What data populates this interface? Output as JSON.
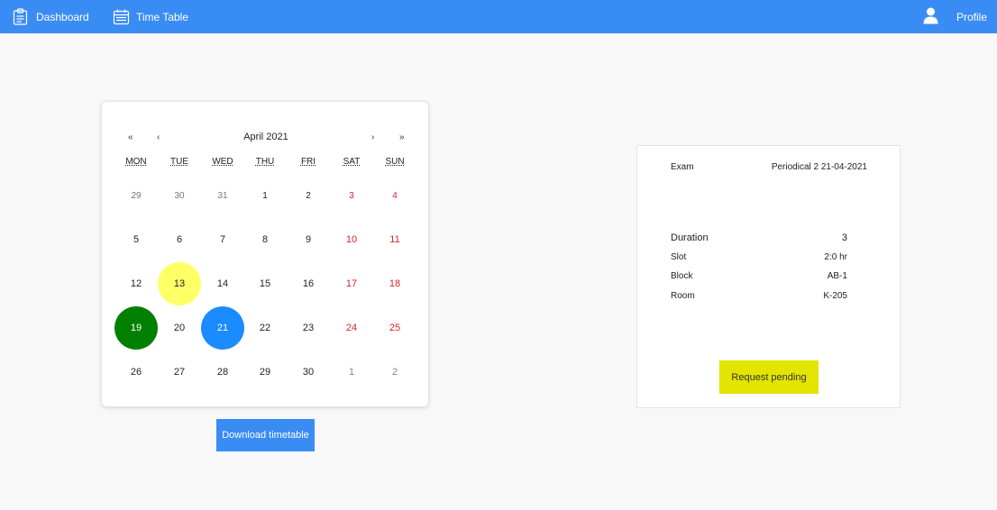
{
  "nav": {
    "dashboard_label": "Dashboard",
    "timetable_label": "Time Table",
    "profile_label": "Profile",
    "bar_color": "#3a8cf5"
  },
  "calendar": {
    "month_label": "April 2021",
    "prev_year": "«",
    "prev_month": "‹",
    "next_month": "›",
    "next_year": "»",
    "weekdays": [
      "MON",
      "TUE",
      "WED",
      "THU",
      "FRI",
      "SAT",
      "SUN"
    ],
    "weeks": [
      [
        {
          "label": "29",
          "other": true
        },
        {
          "label": "30",
          "other": true
        },
        {
          "label": "31",
          "other": true
        },
        {
          "label": "1"
        },
        {
          "label": "2"
        },
        {
          "label": "3",
          "weekend": true
        },
        {
          "label": "4",
          "weekend": true
        }
      ],
      [
        {
          "label": "5"
        },
        {
          "label": "6"
        },
        {
          "label": "7"
        },
        {
          "label": "8"
        },
        {
          "label": "9"
        },
        {
          "label": "10",
          "weekend": true
        },
        {
          "label": "11",
          "weekend": true
        }
      ],
      [
        {
          "label": "12"
        },
        {
          "label": "13",
          "highlight": "#ffff66"
        },
        {
          "label": "14"
        },
        {
          "label": "15"
        },
        {
          "label": "16"
        },
        {
          "label": "17",
          "weekend": true
        },
        {
          "label": "18",
          "weekend": true
        }
      ],
      [
        {
          "label": "19",
          "highlight": "#008000",
          "light": true
        },
        {
          "label": "20"
        },
        {
          "label": "21",
          "highlight": "#1a8cff",
          "light": true
        },
        {
          "label": "22"
        },
        {
          "label": "23"
        },
        {
          "label": "24",
          "weekend": true
        },
        {
          "label": "25",
          "weekend": true
        }
      ],
      [
        {
          "label": "26"
        },
        {
          "label": "27"
        },
        {
          "label": "28"
        },
        {
          "label": "29"
        },
        {
          "label": "30"
        },
        {
          "label": "1",
          "other": true
        },
        {
          "label": "2",
          "other": true
        }
      ]
    ]
  },
  "download_label": "Download timetable",
  "exam": {
    "exam_label": "Exam",
    "exam_value": "Periodical 2 21-04-2021",
    "details": [
      {
        "label": "Duration",
        "value": "3"
      },
      {
        "label": "Slot",
        "value": "2:0 hr"
      },
      {
        "label": "Block",
        "value": "AB-1"
      },
      {
        "label": "Room",
        "value": "K-205"
      }
    ],
    "status_label": "Request pending",
    "status_color": "#e3e400"
  }
}
